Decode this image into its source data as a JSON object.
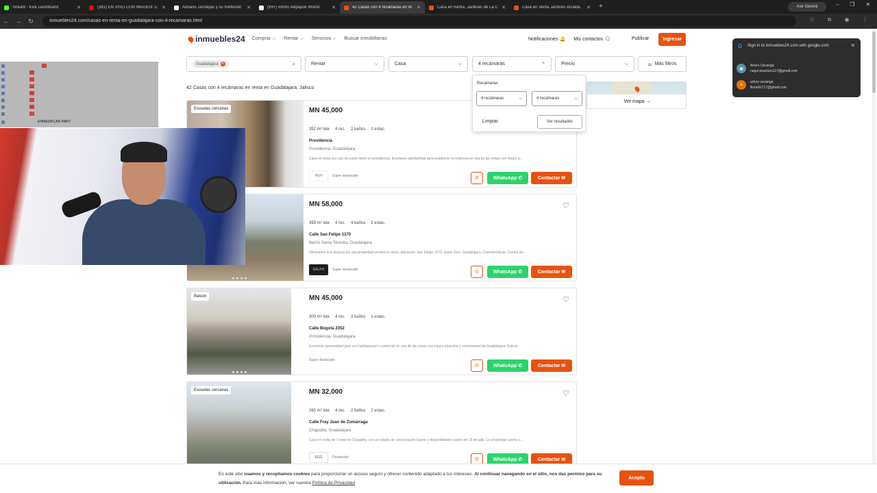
{
  "browser": {
    "tabs": [
      {
        "title": "Stream - Kick Dashboard",
        "color": "#53fc18"
      },
      {
        "title": "(381) EN VIVO CON IMAGEN: C",
        "color": "#ff0000"
      },
      {
        "title": "Adriano Zendejas y su Reflexión",
        "color": "#ffffff"
      },
      {
        "title": "(99+) #shifu #elpapoli #trend",
        "color": "#ffffff"
      },
      {
        "title": "42 Casas con 4 recámaras en re",
        "color": "#e8520f"
      },
      {
        "title": "Casa en Renta, Jardines de La C",
        "color": "#e8520f"
      },
      {
        "title": "Casa en Venta Jardines Alcalde,",
        "color": "#e8520f"
      }
    ],
    "new_tab": "+",
    "gemini": "Ask Gemini",
    "url": "inmuebles24.com/casas-en-renta-en-guadalajara-con-4-recamaras.html"
  },
  "site": {
    "logo": "inmuebles24",
    "nav": [
      "Comprar ⌵",
      "Rentar ⌵",
      "Servicios ⌵",
      "Buscar inmobiliarias"
    ],
    "notificaciones": "Notificaciones 🔔",
    "contactos": "Mis contactos 🗨",
    "publicar": "Publicar",
    "ingresar": "Ingresar"
  },
  "filters": {
    "location_chip": "Guadalajara",
    "operation": "Rentar",
    "type": "Casa",
    "rooms": "4 recámaras",
    "price": "Precio",
    "more": "Más filtros"
  },
  "results_title": "42 Casas con 4 recámaras en renta en Guadalajara, Jalisco",
  "dropdown": {
    "label": "Recámaras",
    "min": "4 recámaras",
    "max": "4 recámaras",
    "clear": "Limpiar",
    "apply": "Ver resultados"
  },
  "map": {
    "label": "Ver mapa →"
  },
  "listings": [
    {
      "badge": "Escuelas cercanas",
      "price": "MN 45,000",
      "features": [
        "352 m² lote",
        "4 rec.",
        "2 baños",
        "1 estac."
      ],
      "address": "Providencia",
      "location": "Providencia, Guadalajara",
      "description": "Casa en renta con uso de suelo mixto en providencia. Excelente oportunidad para establecer tu empresa en una de las zonas con mayor p...",
      "publisher_logo": "PLH",
      "publisher": "Super destacado",
      "whatsapp": "WhatsApp ✆",
      "contact": "Contactar ✉"
    },
    {
      "badge": "",
      "price": "MN 58,000",
      "features": [
        "393 m² lote",
        "4 rec.",
        "4 baños",
        "2 estac."
      ],
      "address": "Calle San Felipe 1370",
      "location": "Barrio Santa Teresita, Guadalajara",
      "description": "Ofrecemos a tu disposición una propiedad versátil en renta, ubicación: San Felipe 1370, Santa Tere, Guadalajara. Características: Consta de...",
      "publisher_logo": "RALPH",
      "publisher": "Super destacado",
      "whatsapp": "WhatsApp ✆",
      "contact": "Contactar ✉"
    },
    {
      "badge": "Balcón",
      "price": "MN 45,000",
      "features": [
        "300 m² lote",
        "4 rec.",
        "3 baños",
        "1 estac."
      ],
      "address": "Calle Bogota 2352",
      "location": "Providencia, Guadalajara",
      "description": "Excelente oportunidad para uso habitacional o comercial en una de las zonas con mayor plusvalía y conectividad de Guadalajara. Esta pr...",
      "publisher_logo": "",
      "publisher": "Super destacado",
      "whatsapp": "WhatsApp ✆",
      "contact": "Contactar ✉"
    },
    {
      "badge": "Escuelas cercanas",
      "price": "MN 32,000",
      "features": [
        "260 m² lote",
        "4 rec.",
        "2 baños",
        "2 estac."
      ],
      "address": "Calle Fray Juan de Zumárraga",
      "location": "Chapalita, Guadalajara",
      "description": "Casa en renta de 1 nivel en Chapalita, con un estado de conservación bueno y disponibilidad a partir del 15 de julio. La propiedad cuenta c...",
      "publisher_logo": "EGG",
      "publisher": "Destacado",
      "whatsapp": "WhatsApp ✆",
      "contact": "Contactar ✉"
    }
  ],
  "google_popup": {
    "title": "Sign in to inmuebles24.com with google.com",
    "accounts": [
      {
        "name": "Arturo Uscanga",
        "email": "negociosarturo117@gmail.com",
        "initial": "",
        "color": "#5a8fb0"
      },
      {
        "name": "arturo uscanga",
        "email": "llionell1717@gmail.com",
        "initial": "a",
        "color": "#e8710a"
      }
    ]
  },
  "stream_overlay": {
    "chat_last": "ENMAZATLAN PAPO"
  },
  "cookie": {
    "t1": "En este sitio ",
    "b1": "usamos y recopilamos cookies",
    "t2": " para proporcionar un acceso seguro y ofrecer contenido adaptado a tus intereses. ",
    "b2": "Al continuar navegando en el sitio, nos das permiso para su utilización.",
    "t3": " Para más información, ver nuestra ",
    "link": "Política de Privacidad",
    "accept": "Acepto"
  }
}
